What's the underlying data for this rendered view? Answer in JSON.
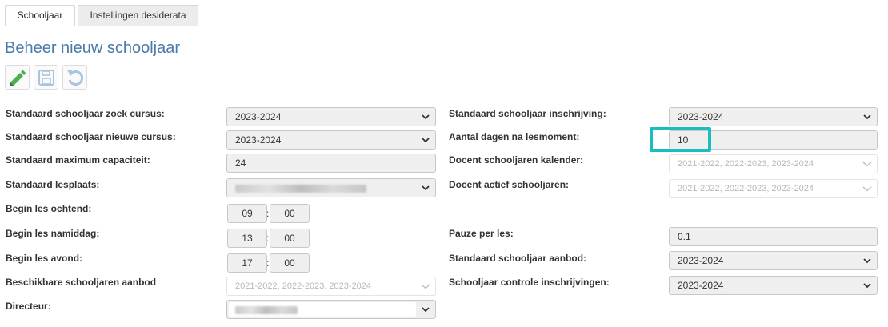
{
  "tabs": [
    {
      "label": "Schooljaar",
      "active": true
    },
    {
      "label": "Instellingen desiderata",
      "active": false
    }
  ],
  "page": {
    "title": "Beheer nieuw schooljaar"
  },
  "toolbar": {
    "edit_icon": "pencil-icon",
    "save_icon": "floppy-disk-icon",
    "undo_icon": "undo-icon",
    "edit_color": "#4caf50"
  },
  "left": {
    "zoek_cursus": {
      "label": "Standaard schooljaar zoek cursus:",
      "value": "2023-2024"
    },
    "nieuwe_cursus": {
      "label": "Standaard schooljaar nieuwe cursus:",
      "value": "2023-2024"
    },
    "max_capaciteit": {
      "label": "Standaard maximum capaciteit:",
      "value": "24"
    },
    "lesplaats": {
      "label": "Standaard lesplaats:"
    },
    "ochtend": {
      "label": "Begin les ochtend:",
      "hour": "09",
      "minute": "00"
    },
    "namiddag": {
      "label": "Begin les namiddag:",
      "hour": "13",
      "minute": "00"
    },
    "avond": {
      "label": "Begin les avond:",
      "hour": "17",
      "minute": "00"
    },
    "beschikbare": {
      "label": "Beschikbare schooljaren aanbod",
      "value": "2021-2022, 2022-2023, 2023-2024"
    },
    "directeur": {
      "label": "Directeur:"
    }
  },
  "right": {
    "inschrijving": {
      "label": "Standaard schooljaar inschrijving:",
      "value": "2023-2024"
    },
    "aantal_dagen": {
      "label": "Aantal dagen na lesmoment:",
      "value": "10"
    },
    "docent_kalender": {
      "label": "Docent schooljaren kalender:",
      "value": "2021-2022, 2022-2023, 2023-2024"
    },
    "docent_actief": {
      "label": "Docent actief schooljaren:",
      "value": "2021-2022, 2022-2023, 2023-2024"
    },
    "pauze": {
      "label": "Pauze per les:",
      "value": "0.1"
    },
    "aanbod": {
      "label": "Standaard schooljaar aanbod:",
      "value": "2023-2024"
    },
    "controle": {
      "label": "Schooljaar controle inschrijvingen:",
      "value": "2023-2024"
    }
  },
  "time_separator": ":",
  "colors": {
    "title": "#4a7ba8",
    "highlight": "#1bbdbd"
  }
}
